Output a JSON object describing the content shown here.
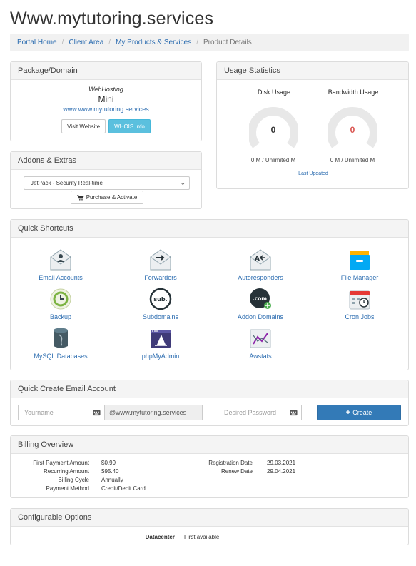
{
  "page_title": "Www.mytutoring.services",
  "breadcrumb": {
    "items": [
      "Portal Home",
      "Client Area",
      "My Products & Services"
    ],
    "active": "Product Details"
  },
  "package": {
    "header": "Package/Domain",
    "type": "WebHosting",
    "name": "Mini",
    "domain": "www.www.mytutoring.services",
    "visit_button": "Visit Website",
    "whois_button": "WHOIS Info"
  },
  "addons": {
    "header": "Addons & Extras",
    "selected": "JetPack - Security Real-time",
    "purchase_button": "Purchase & Activate"
  },
  "usage": {
    "header": "Usage Statistics",
    "disk_label": "Disk Usage",
    "disk_value": "0",
    "disk_sub": "0 M / Unlimited M",
    "bandwidth_label": "Bandwidth Usage",
    "bandwidth_value": "0",
    "bandwidth_sub": "0 M / Unlimited M",
    "last_updated": "Last Updated",
    "colors": {
      "disk_value": "#333333",
      "bandwidth_value": "#d9534f",
      "gauge_track": "#e8e8e8"
    }
  },
  "shortcuts": {
    "header": "Quick Shortcuts",
    "items": [
      {
        "label": "Email Accounts",
        "icon": "email-accounts-icon"
      },
      {
        "label": "Forwarders",
        "icon": "forwarders-icon"
      },
      {
        "label": "Autoresponders",
        "icon": "autoresponders-icon"
      },
      {
        "label": "File Manager",
        "icon": "file-manager-icon"
      },
      {
        "label": "Backup",
        "icon": "backup-icon"
      },
      {
        "label": "Subdomains",
        "icon": "subdomains-icon"
      },
      {
        "label": "Addon Domains",
        "icon": "addon-domains-icon"
      },
      {
        "label": "Cron Jobs",
        "icon": "cron-jobs-icon"
      },
      {
        "label": "MySQL Databases",
        "icon": "mysql-databases-icon"
      },
      {
        "label": "phpMyAdmin",
        "icon": "phpmyadmin-icon"
      },
      {
        "label": "Awstats",
        "icon": "awstats-icon"
      }
    ],
    "sub_icon_text": "sub.",
    "com_icon_text": ".com"
  },
  "email": {
    "header": "Quick Create Email Account",
    "username_placeholder": "Yourname",
    "domain_suffix": "@www.mytutoring.services",
    "password_placeholder": "Desired Password",
    "create_button": "Create"
  },
  "billing": {
    "header": "Billing Overview",
    "left": [
      {
        "label": "First Payment Amount",
        "value": "$0.99"
      },
      {
        "label": "Recurring Amount",
        "value": "$95.40"
      },
      {
        "label": "Billing Cycle",
        "value": "Annually"
      },
      {
        "label": "Payment Method",
        "value": "Credit/Debit Card"
      }
    ],
    "right": [
      {
        "label": "Registration Date",
        "value": "29.03.2021"
      },
      {
        "label": "Renew Date",
        "value": "29.04.2021"
      }
    ]
  },
  "config": {
    "header": "Configurable Options",
    "label": "Datacenter",
    "value": "First available"
  }
}
